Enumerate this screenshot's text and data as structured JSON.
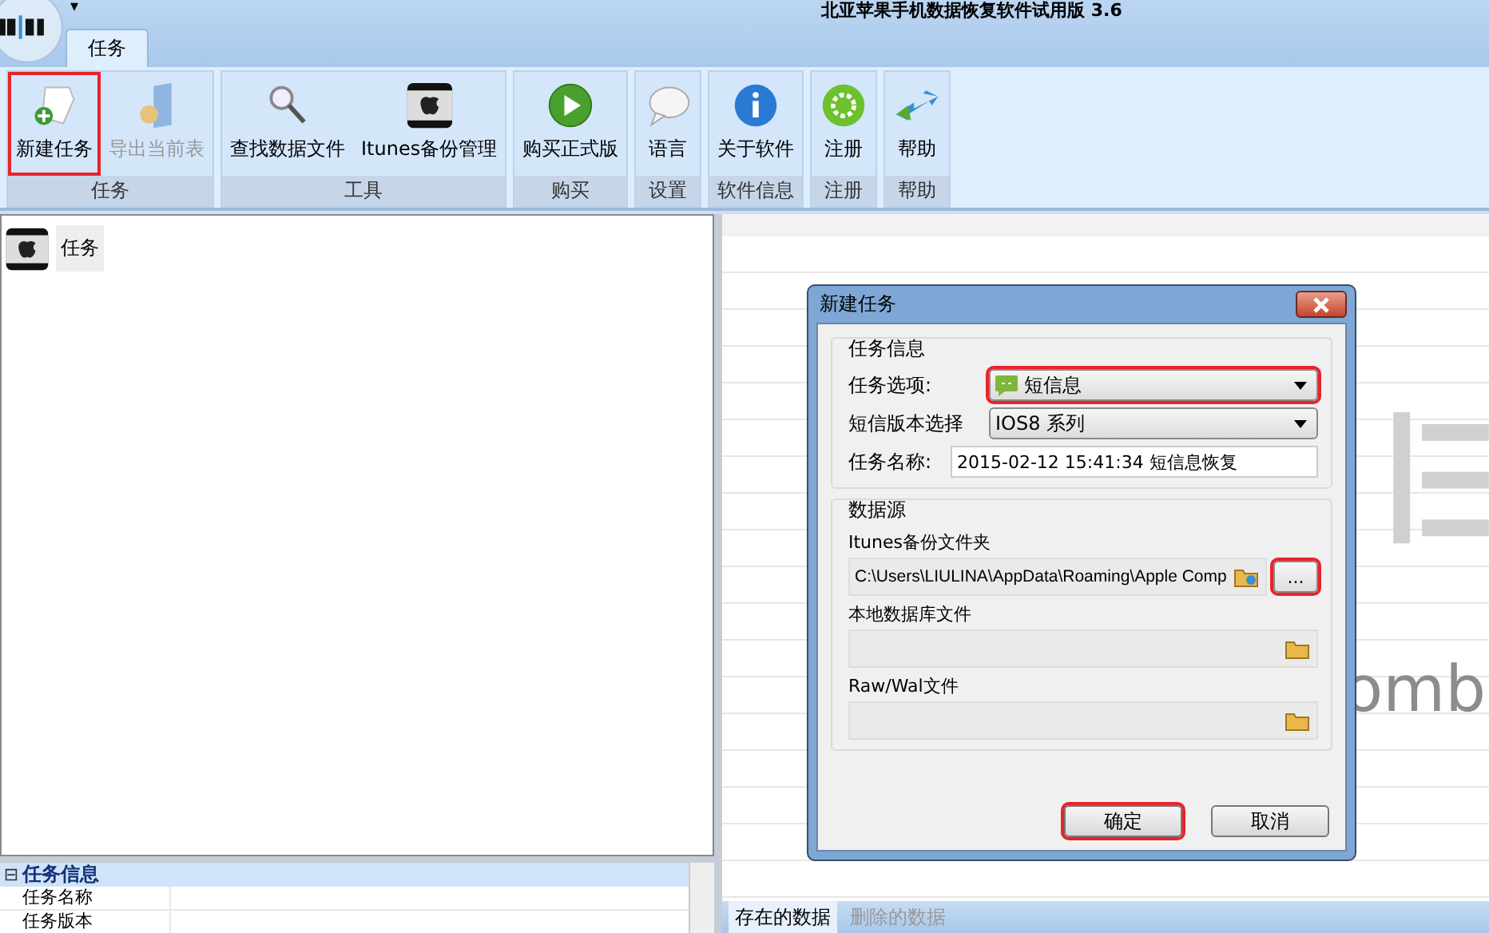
{
  "app": {
    "title": "北亚苹果手机数据恢复软件试用版 3.6",
    "quick_access": "▾",
    "tabs": [
      {
        "label": "任务",
        "selected": true
      }
    ]
  },
  "ribbon": {
    "groups": [
      {
        "label": "任务",
        "buttons": [
          {
            "label": "新建任务",
            "disabled": false,
            "highlighted": true
          },
          {
            "label": "导出当前表",
            "disabled": true,
            "highlighted": false
          }
        ]
      },
      {
        "label": "工具",
        "buttons": [
          {
            "label": "查找数据文件",
            "disabled": false,
            "highlighted": false
          },
          {
            "label": "Itunes备份管理",
            "disabled": false,
            "highlighted": false
          }
        ]
      },
      {
        "label": "购买",
        "buttons": [
          {
            "label": "购买正式版",
            "disabled": false,
            "highlighted": false
          }
        ]
      },
      {
        "label": "设置",
        "buttons": [
          {
            "label": "语言",
            "disabled": false,
            "highlighted": false
          }
        ]
      },
      {
        "label": "软件信息",
        "buttons": [
          {
            "label": "关于软件",
            "disabled": false,
            "highlighted": false
          }
        ]
      },
      {
        "label": "注册",
        "buttons": [
          {
            "label": "注册",
            "disabled": false,
            "highlighted": false
          }
        ]
      },
      {
        "label": "帮助",
        "buttons": [
          {
            "label": "帮助",
            "disabled": false,
            "highlighted": false
          }
        ]
      }
    ]
  },
  "task_tree": {
    "items": [
      {
        "label": "任务",
        "selected": true
      }
    ]
  },
  "properties": {
    "category": "任务信息",
    "expanded": true,
    "collapse_sign": "⊟",
    "rows": [
      "任务名称",
      "任务版本"
    ]
  },
  "background_logo": "omb",
  "data_tabs": [
    {
      "label": "存在的数据",
      "selected": true
    },
    {
      "label": "删除的数据",
      "selected": false
    }
  ],
  "dialog": {
    "title": "新建任务",
    "task_info": {
      "title": "任务信息",
      "option_label": "任务选项:",
      "option_value": "短信息",
      "option_highlighted": true,
      "version_label": "短信版本选择",
      "version_value": "IOS8 系列",
      "name_label": "任务名称:",
      "name_value": "2015-02-12 15:41:34 短信息恢复"
    },
    "data_source": {
      "title": "数据源",
      "fields": [
        {
          "label": "Itunes备份文件夹",
          "value": "C:\\Users\\LIULINA\\AppData\\Roaming\\Apple Comp",
          "browse_button": "...",
          "browse_highlighted": true
        },
        {
          "label": "本地数据库文件"
        },
        {
          "label": "Raw/Wal文件"
        }
      ]
    },
    "buttons": [
      {
        "label": "确定",
        "highlighted": true
      },
      {
        "label": "取消",
        "highlighted": false
      }
    ]
  }
}
